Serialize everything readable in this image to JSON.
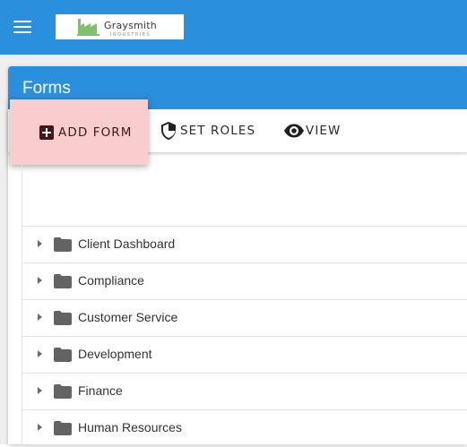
{
  "header": {
    "menu_icon": "hamburger-menu-icon",
    "logo": {
      "name": "Graysmith",
      "subtitle": "INDUSTRIES",
      "icon": "factory-icon",
      "icon_color": "#7fc06a"
    },
    "color": "#2a8fdc"
  },
  "panel": {
    "title": "Forms",
    "header_color": "#2a8fdc"
  },
  "toolbar": {
    "add_form_label": "ADD FORM",
    "add_form_icon": "plus-box-icon",
    "add_form_highlight": "#f9cccd",
    "set_roles_label": "SET ROLES",
    "set_roles_icon": "shield-icon",
    "view_label": "VIEW",
    "view_icon": "eye-icon"
  },
  "tree": {
    "folder_icon": "folder-icon",
    "expand_icon": "caret-right-icon",
    "items": [
      {
        "label": "Client Dashboard"
      },
      {
        "label": "Compliance"
      },
      {
        "label": "Customer Service"
      },
      {
        "label": "Development"
      },
      {
        "label": "Finance"
      },
      {
        "label": "Human Resources"
      }
    ]
  }
}
